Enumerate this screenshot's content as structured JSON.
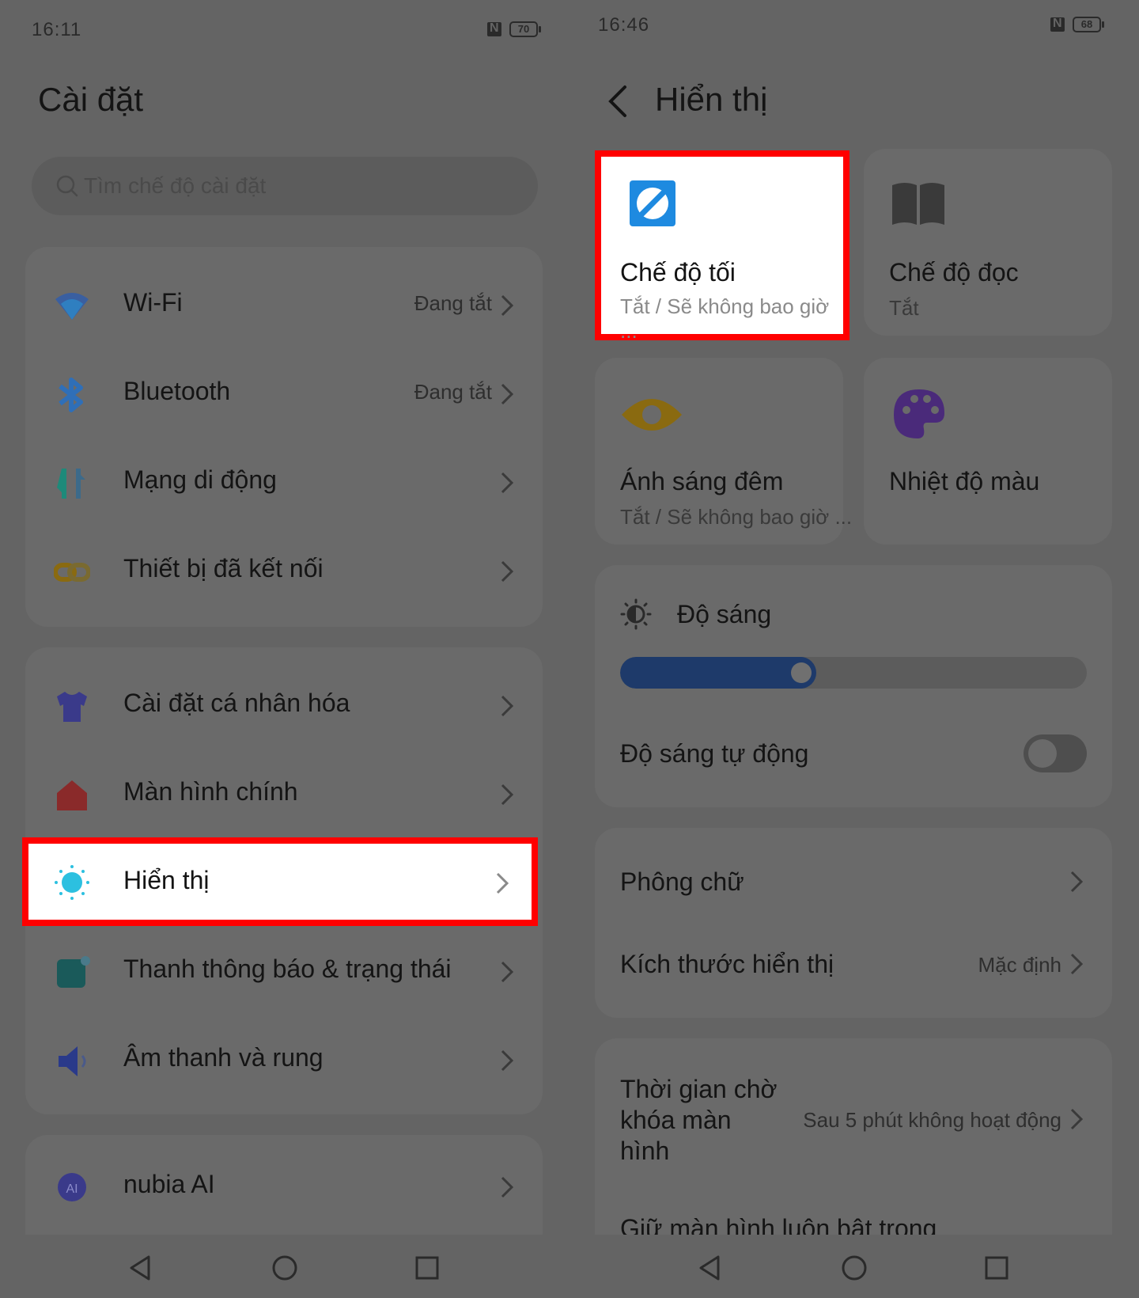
{
  "left": {
    "status": {
      "time": "16:11",
      "battery": "70"
    },
    "title": "Cài đặt",
    "search": {
      "placeholder": "Tìm chế độ cài đặt"
    },
    "group1": [
      {
        "label": "Wi-Fi",
        "value": "Đang tắt",
        "icon": "wifi-icon"
      },
      {
        "label": "Bluetooth",
        "value": "Đang tắt",
        "icon": "bluetooth-icon"
      },
      {
        "label": "Mạng di động",
        "value": "",
        "icon": "mobile-data-icon"
      },
      {
        "label": "Thiết bị đã kết nối",
        "value": "",
        "icon": "link-icon"
      }
    ],
    "group2": [
      {
        "label": "Cài đặt cá nhân hóa",
        "icon": "shirt-icon"
      },
      {
        "label": "Màn hình chính",
        "icon": "home-icon"
      },
      {
        "label": "Hiển thị",
        "icon": "sun-icon"
      },
      {
        "label": "Thanh thông báo & trạng thái",
        "icon": "notification-icon"
      },
      {
        "label": "Âm thanh và rung",
        "icon": "speaker-icon"
      }
    ],
    "group3": [
      {
        "label": "nubia AI",
        "icon": "ai-icon"
      }
    ]
  },
  "right": {
    "status": {
      "time": "16:46",
      "battery": "68"
    },
    "title": "Hiển thị",
    "tiles": [
      {
        "title": "Chế độ tối",
        "subtitle": "Tắt / Sẽ không bao giờ ...",
        "icon": "dark-mode-icon"
      },
      {
        "title": "Chế độ đọc",
        "subtitle": "Tắt",
        "icon": "book-icon"
      },
      {
        "title": "Ánh sáng đêm",
        "subtitle": "Tắt / Sẽ không bao giờ ...",
        "icon": "eye-icon"
      },
      {
        "title": "Nhiệt độ màu",
        "subtitle": "",
        "icon": "palette-icon"
      }
    ],
    "brightness": {
      "label": "Độ sáng",
      "level": 0.42,
      "auto_label": "Độ sáng tự động",
      "auto_on": false
    },
    "font": {
      "label": "Phông chữ"
    },
    "display_size": {
      "label": "Kích thước hiển thị",
      "value": "Mặc định"
    },
    "timeout": {
      "label_line1": "Thời gian chờ",
      "label_line2": "khóa màn",
      "label_line3": "hình",
      "value": "Sau 5 phút không hoạt động"
    },
    "keep_on": {
      "label": "Giữ màn hình luôn bật trong"
    }
  },
  "colors": {
    "highlight": "#ff0000",
    "accent": "#1e5fa8"
  }
}
